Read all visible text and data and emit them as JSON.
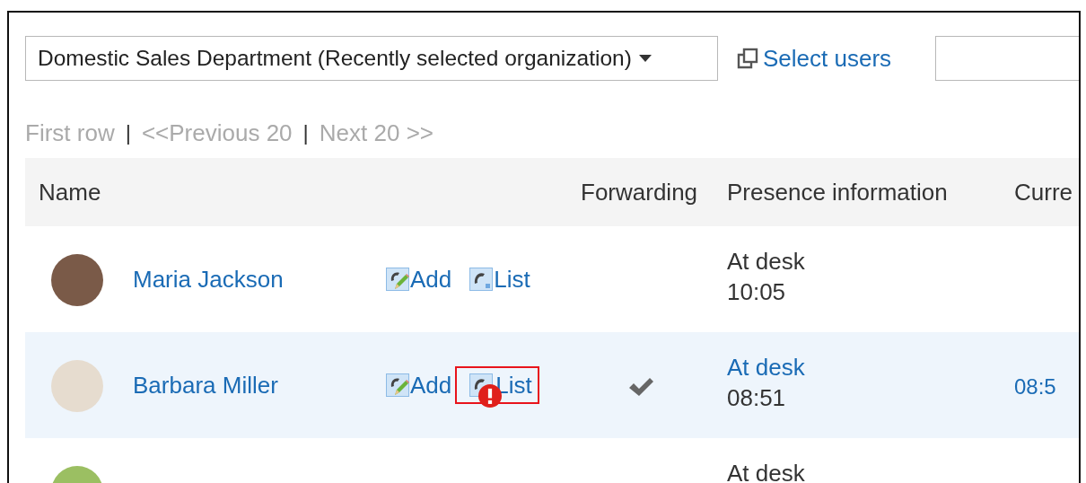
{
  "toolbar": {
    "organization_select": {
      "value": "Domestic Sales Department (Recently selected organization)"
    },
    "select_users_link": "Select users"
  },
  "pagination": [
    {
      "kind": "link",
      "text": "First row",
      "disabled": true
    },
    {
      "kind": "separator",
      "text": "|"
    },
    {
      "kind": "link",
      "text": "<<Previous 20",
      "disabled": true
    },
    {
      "kind": "separator",
      "text": "|"
    },
    {
      "kind": "link",
      "text": "Next 20 >>",
      "disabled": true
    }
  ],
  "table": {
    "columns": [
      "Name",
      "Forwarding",
      "Presence information",
      "Curre"
    ],
    "rows": [
      {
        "selected": false,
        "name": "Maria Jackson",
        "actions": [
          {
            "kind": "add",
            "label": "Add",
            "alert": false,
            "highlighted": false
          },
          {
            "kind": "list",
            "label": "List",
            "alert": false,
            "highlighted": false
          }
        ],
        "forwarding": false,
        "presence": {
          "status": "At desk",
          "linked": false,
          "time": "10:05"
        }
      },
      {
        "selected": true,
        "name": "Barbara Miller",
        "actions": [
          {
            "kind": "add",
            "label": "Add",
            "alert": false,
            "highlighted": false
          },
          {
            "kind": "list",
            "label": "List",
            "alert": true,
            "highlighted": true
          }
        ],
        "forwarding": true,
        "presence": {
          "status": "At desk",
          "linked": true,
          "time": "08:51"
        },
        "current": "08:5"
      },
      {
        "selected": false,
        "forwarding": false,
        "presence": {
          "status": "At desk",
          "linked": false
        }
      }
    ]
  }
}
